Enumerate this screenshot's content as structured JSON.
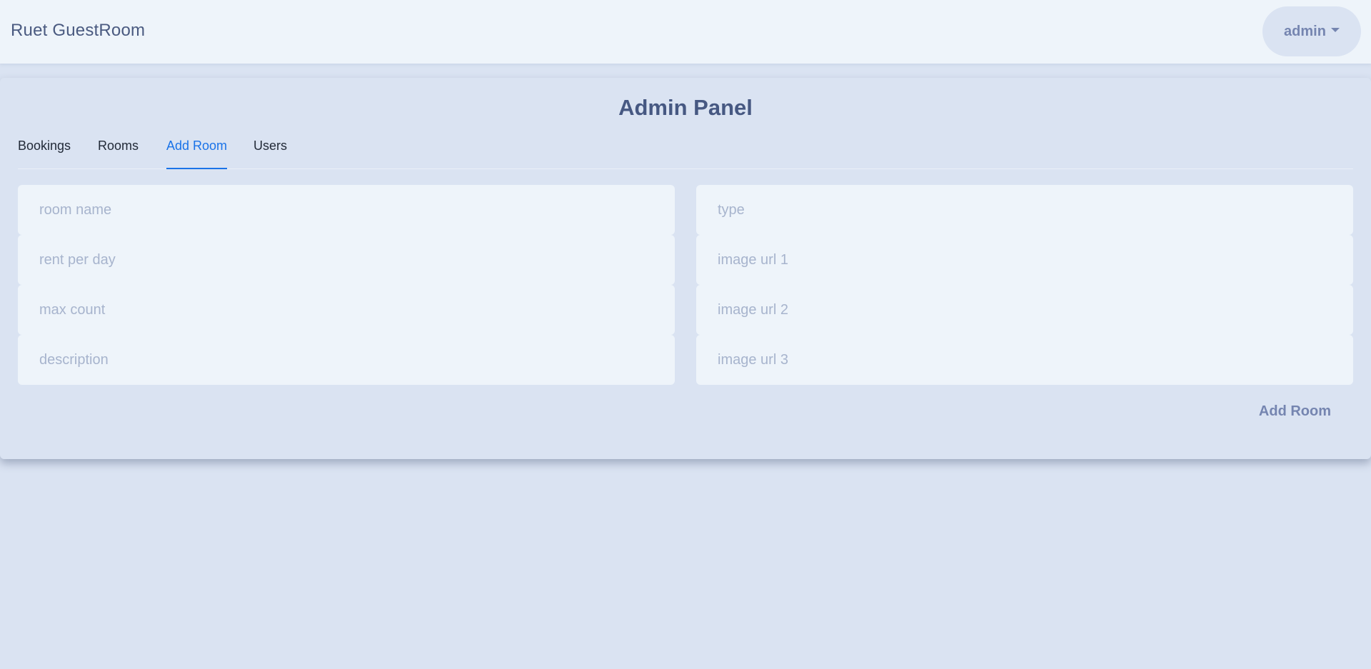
{
  "header": {
    "brand": "Ruet GuestRoom",
    "user_menu_label": "admin"
  },
  "panel": {
    "title": "Admin Panel",
    "tabs": [
      {
        "label": "Bookings"
      },
      {
        "label": "Rooms"
      },
      {
        "label": "Add Room"
      },
      {
        "label": "Users"
      }
    ],
    "active_tab": "Add Room"
  },
  "form": {
    "room_name": {
      "placeholder": "room name",
      "value": ""
    },
    "rent_per_day": {
      "placeholder": "rent per day",
      "value": ""
    },
    "max_count": {
      "placeholder": "max count",
      "value": ""
    },
    "description": {
      "placeholder": "description",
      "value": ""
    },
    "type": {
      "placeholder": "type",
      "value": ""
    },
    "image_url_1": {
      "placeholder": "image url 1",
      "value": ""
    },
    "image_url_2": {
      "placeholder": "image url 2",
      "value": ""
    },
    "image_url_3": {
      "placeholder": "image url 3",
      "value": ""
    },
    "submit_label": "Add Room"
  },
  "colors": {
    "background": "#dae3f2",
    "navbar": "#eef4fa",
    "accent": "#1a73e8",
    "title": "#465882",
    "muted": "#7585b0"
  }
}
